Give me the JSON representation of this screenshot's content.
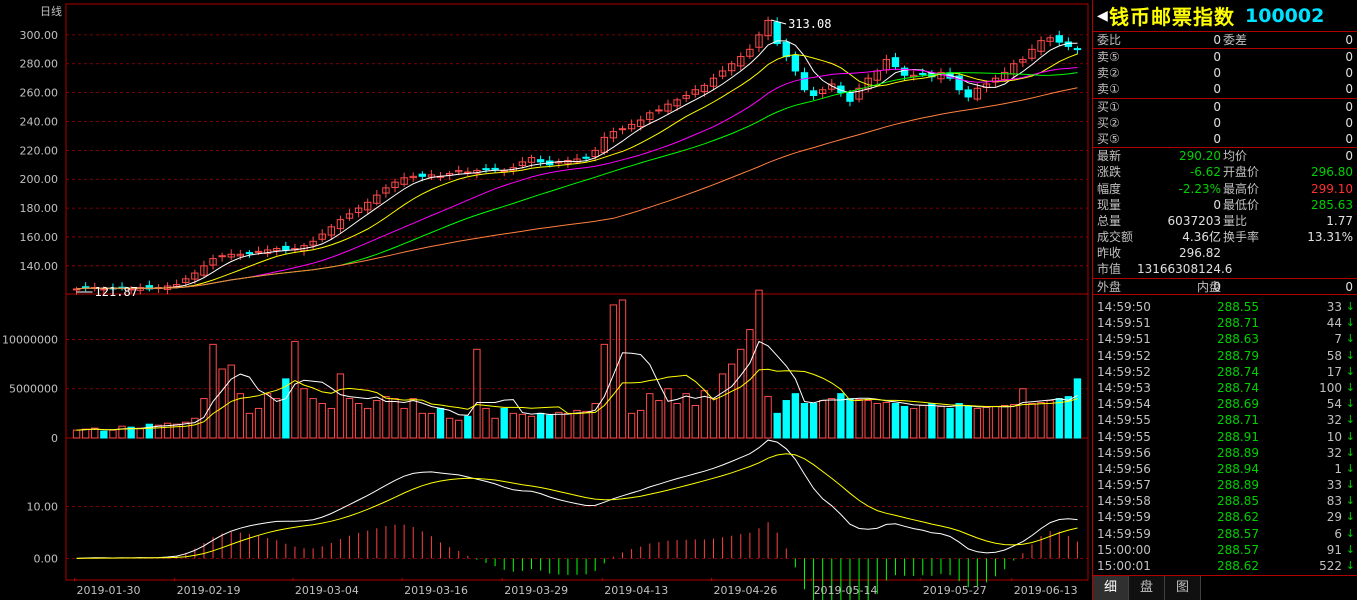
{
  "chart": {
    "period_label": "日线",
    "price_axis": [
      "300.00",
      "280.00",
      "260.00",
      "240.00",
      "220.00",
      "200.00",
      "180.00",
      "160.00",
      "140.00"
    ],
    "high_marker": "313.08",
    "low_marker": "121.87",
    "volume_axis": [
      "10000000",
      "5000000",
      "0"
    ],
    "indicator_axis": [
      "10.00",
      "0.00"
    ],
    "dates": [
      "2019-01-30",
      "2019-02-19",
      "2019-03-04",
      "2019-03-16",
      "2019-03-29",
      "2019-04-13",
      "2019-04-26",
      "2019-05-14",
      "2019-05-27",
      "2019-06-13"
    ]
  },
  "chart_data": {
    "type": "candlestick",
    "price_ylim": [
      121.87,
      313.08
    ],
    "volume_ylim": [
      0,
      14000000
    ],
    "close_series": [
      124,
      125,
      125,
      124,
      124,
      125,
      124,
      125,
      124,
      125,
      126,
      127,
      131,
      135,
      140,
      145,
      147,
      148,
      148,
      149,
      150,
      151,
      152,
      151,
      152,
      154,
      157,
      162,
      167,
      172,
      176,
      180,
      184,
      189,
      194,
      198,
      201,
      202,
      202,
      203,
      202,
      204,
      206,
      205,
      206,
      207,
      207,
      206,
      208,
      212,
      215,
      212,
      210,
      212,
      213,
      214,
      215,
      220,
      229,
      233,
      235,
      238,
      241,
      246,
      248,
      252,
      255,
      258,
      262,
      265,
      270,
      275,
      280,
      285,
      290,
      300,
      310,
      294,
      285,
      275,
      262,
      258,
      262,
      266,
      260,
      254,
      263,
      270,
      275,
      283,
      278,
      272,
      272,
      273,
      271,
      274,
      270,
      262,
      257,
      263,
      266,
      270,
      274,
      280,
      283,
      290,
      296,
      298,
      295,
      292,
      290
    ],
    "volume_series": [
      800000,
      900000,
      1000000,
      700000,
      800000,
      1200000,
      1100000,
      1000000,
      1400000,
      1300000,
      1500000,
      1400000,
      1600000,
      2000000,
      4000000,
      9500000,
      7000000,
      7400000,
      4500000,
      2500000,
      3000000,
      4500000,
      4000000,
      6000000,
      9800000,
      5000000,
      4000000,
      3500000,
      3000000,
      6500000,
      4000000,
      3500000,
      3000000,
      3800000,
      4200000,
      4000000,
      3000000,
      4000000,
      2500000,
      2500000,
      3000000,
      2000000,
      1800000,
      2200000,
      9000000,
      3000000,
      2000000,
      3000000,
      2500000,
      2400000,
      2200000,
      2500000,
      2300000,
      2600000,
      2500000,
      2800000,
      2700000,
      3500000,
      9500000,
      13500000,
      14000000,
      2500000,
      2800000,
      4500000,
      3800000,
      5000000,
      3500000,
      4500000,
      3300000,
      4800000,
      4000000,
      6500000,
      7500000,
      9000000,
      11000000,
      15000000,
      4200000,
      2500000,
      3800000,
      4500000,
      3500000,
      3500000,
      3800000,
      4000000,
      4500000,
      4000000,
      3900000,
      3800000,
      3500000,
      3600000,
      3500000,
      3200000,
      3000000,
      3300000,
      3500000,
      3200000,
      3000000,
      3500000,
      3200000,
      3000000,
      3100000,
      3200000,
      3300000,
      3400000,
      5000000,
      3500000,
      3600000,
      3800000,
      4000000,
      4200000,
      6000000
    ],
    "ma_lines": [
      "ma5",
      "ma10",
      "ma20",
      "ma30",
      "ma60"
    ],
    "indicator_ylim": [
      -3,
      22
    ]
  },
  "quote": {
    "title_arrow": "◀",
    "name": "钱币邮票指数",
    "code": "100002",
    "weibi_label": "委比",
    "weibi": "0",
    "weicha_label": "委差",
    "weicha": "0",
    "sell": [
      {
        "label": "卖⑤",
        "p": "0",
        "v": "0"
      },
      {
        "label": "卖②",
        "p": "0",
        "v": "0"
      },
      {
        "label": "卖①",
        "p": "0",
        "v": "0"
      }
    ],
    "buy": [
      {
        "label": "买①",
        "p": "0",
        "v": "0"
      },
      {
        "label": "买②",
        "p": "0",
        "v": "0"
      },
      {
        "label": "买⑤",
        "p": "0",
        "v": "0"
      }
    ],
    "latest_label": "最新",
    "latest": "290.20",
    "avg_label": "均价",
    "avg": "0",
    "change_label": "涨跌",
    "change": "-6.62",
    "open_label": "开盘价",
    "open": "296.80",
    "pct_label": "幅度",
    "pct": "-2.23%",
    "high_label": "最高价",
    "high": "299.10",
    "curvol_label": "现量",
    "curvol": "0",
    "low_label": "最低价",
    "low": "285.63",
    "totvol_label": "总量",
    "totvol": "6037203",
    "ratio_label": "量比",
    "ratio": "1.77",
    "amount_label": "成交额",
    "amount": "4.36亿",
    "turnover_label": "换手率",
    "turnover": "13.31%",
    "prev_label": "昨收",
    "prev": "296.82",
    "mcap_label": "市值",
    "mcap": "13166308124.6",
    "outer_label": "外盘",
    "outer": "0",
    "inner_label": "内盘",
    "inner": "0"
  },
  "ticks": [
    {
      "t": "14:59:50",
      "p": "288.55",
      "q": "33"
    },
    {
      "t": "14:59:51",
      "p": "288.71",
      "q": "44"
    },
    {
      "t": "14:59:51",
      "p": "288.63",
      "q": "7"
    },
    {
      "t": "14:59:52",
      "p": "288.79",
      "q": "58"
    },
    {
      "t": "14:59:52",
      "p": "288.74",
      "q": "17"
    },
    {
      "t": "14:59:53",
      "p": "288.74",
      "q": "100"
    },
    {
      "t": "14:59:54",
      "p": "288.69",
      "q": "54"
    },
    {
      "t": "14:59:55",
      "p": "288.71",
      "q": "32"
    },
    {
      "t": "14:59:55",
      "p": "288.91",
      "q": "10"
    },
    {
      "t": "14:59:56",
      "p": "288.89",
      "q": "32"
    },
    {
      "t": "14:59:56",
      "p": "288.94",
      "q": "1"
    },
    {
      "t": "14:59:57",
      "p": "288.89",
      "q": "33"
    },
    {
      "t": "14:59:58",
      "p": "288.85",
      "q": "83"
    },
    {
      "t": "14:59:59",
      "p": "288.62",
      "q": "29"
    },
    {
      "t": "14:59:59",
      "p": "288.57",
      "q": "6"
    },
    {
      "t": "15:00:00",
      "p": "288.57",
      "q": "91"
    },
    {
      "t": "15:00:01",
      "p": "288.62",
      "q": "522"
    }
  ],
  "tick_dir": "↓",
  "tabs": [
    "细",
    "盘",
    "图"
  ]
}
